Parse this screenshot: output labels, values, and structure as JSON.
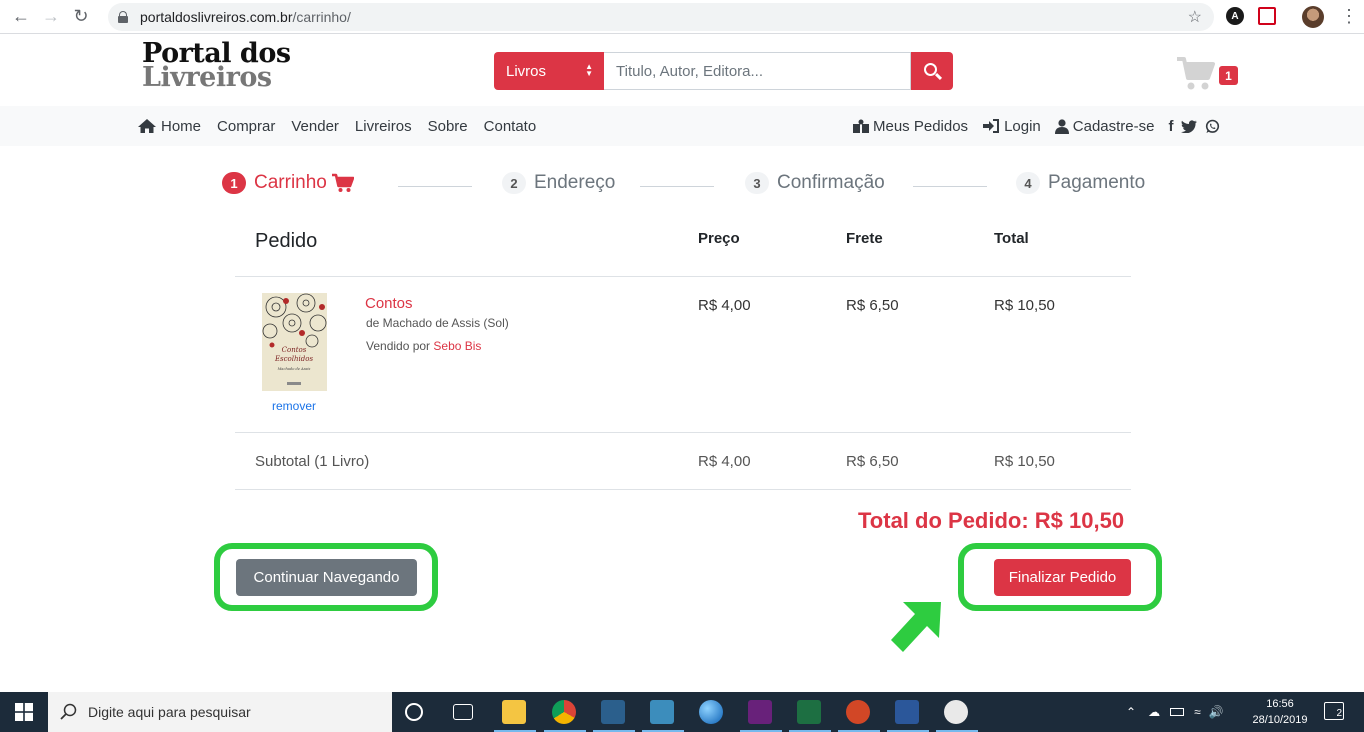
{
  "browser": {
    "url_host": "portaldoslivreiros.com.br",
    "url_path": "/carrinho/"
  },
  "header": {
    "logo_line1": "Portal dos",
    "logo_line2": "Livreiros",
    "search_category": "Livros",
    "search_placeholder": "Titulo, Autor, Editora...",
    "cart_count": "1"
  },
  "nav": {
    "left": [
      "Home",
      "Comprar",
      "Vender",
      "Livreiros",
      "Sobre",
      "Contato"
    ],
    "my_orders": "Meus Pedidos",
    "login": "Login",
    "signup": "Cadastre-se"
  },
  "steps": [
    {
      "num": "1",
      "label": "Carrinho"
    },
    {
      "num": "2",
      "label": "Endereço"
    },
    {
      "num": "3",
      "label": "Confirmação"
    },
    {
      "num": "4",
      "label": "Pagamento"
    }
  ],
  "table": {
    "headers": {
      "order": "Pedido",
      "price": "Preço",
      "shipping": "Frete",
      "total": "Total"
    },
    "item": {
      "title": "Contos",
      "author": "de Machado de Assis (Sol)",
      "sold_by": "Vendido por",
      "seller": "Sebo Bis",
      "remove": "remover",
      "cover_title": "Contos Escolhidos",
      "cover_author": "Machado de Assis",
      "price": "R$ 4,00",
      "shipping": "R$ 6,50",
      "total": "R$ 10,50"
    },
    "subtotal": {
      "label": "Subtotal (1 Livro)",
      "price": "R$ 4,00",
      "shipping": "R$ 6,50",
      "total": "R$ 10,50"
    }
  },
  "order_total": "Total do Pedido: R$ 10,50",
  "buttons": {
    "continue": "Continuar Navegando",
    "finalize": "Finalizar Pedido"
  },
  "taskbar": {
    "search_placeholder": "Digite aqui para pesquisar",
    "time": "16:56",
    "date": "28/10/2019",
    "notifications": "2"
  },
  "colors": {
    "accent": "#dc3545",
    "highlight": "#2ecc40"
  }
}
